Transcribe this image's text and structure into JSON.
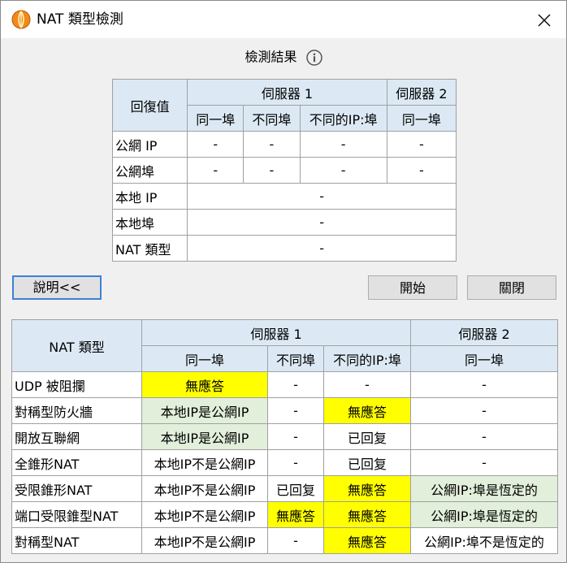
{
  "window": {
    "title": "NAT 類型檢測",
    "app_icon": "orange-sphere-app-icon",
    "close_icon": "close-x-icon"
  },
  "result": {
    "heading": "檢測結果",
    "info_icon": "info-circle-icon",
    "col_header": "回復值",
    "server1": "伺服器 1",
    "server2": "伺服器 2",
    "sub_same_port": "同一埠",
    "sub_diff_port": "不同埠",
    "sub_diff_ip_port": "不同的IP:埠",
    "sub_same_port_2": "同一埠",
    "rows": [
      {
        "label": "公網 IP",
        "c1": "-",
        "c2": "-",
        "c3": "-",
        "c4": "-"
      },
      {
        "label": "公網埠",
        "c1": "-",
        "c2": "-",
        "c3": "-",
        "c4": "-"
      }
    ],
    "span_rows": [
      {
        "label": "本地 IP",
        "value": "-"
      },
      {
        "label": "本地埠",
        "value": "-"
      },
      {
        "label": "NAT 類型",
        "value": "-"
      }
    ]
  },
  "buttons": {
    "explain": "說明<<",
    "start": "開始",
    "close": "關閉"
  },
  "legend": {
    "col_header": "NAT 類型",
    "server1": "伺服器 1",
    "server2": "伺服器 2",
    "sub_same_port": "同一埠",
    "sub_diff_port": "不同埠",
    "sub_diff_ip_port": "不同的IP:埠",
    "sub_same_port_2": "同一埠",
    "highlight_colors": {
      "yellow": "#ffff00",
      "green": "#e2efda"
    },
    "rows": [
      {
        "type": "UDP 被阻攔",
        "c1": "無應答",
        "c2": "-",
        "c3": "-",
        "c4": "-"
      },
      {
        "type": "對稱型防火牆",
        "c1": "本地IP是公網IP",
        "c2": "-",
        "c3": "無應答",
        "c4": "-"
      },
      {
        "type": "開放互聯網",
        "c1": "本地IP是公網IP",
        "c2": "-",
        "c3": "已回复",
        "c4": "-"
      },
      {
        "type": "全錐形NAT",
        "c1": "本地IP不是公網IP",
        "c2": "-",
        "c3": "已回复",
        "c4": "-"
      },
      {
        "type": "受限錐形NAT",
        "c1": "本地IP不是公網IP",
        "c2": "已回复",
        "c3": "無應答",
        "c4": "公網IP:埠是恆定的"
      },
      {
        "type": "端口受限錐型NAT",
        "c1": "本地IP不是公網IP",
        "c2": "無應答",
        "c3": "無應答",
        "c4": "公網IP:埠是恆定的"
      },
      {
        "type": "對稱型NAT",
        "c1": "本地IP不是公網IP",
        "c2": "-",
        "c3": "無應答",
        "c4": "公網IP:埠不是恆定的"
      }
    ]
  }
}
